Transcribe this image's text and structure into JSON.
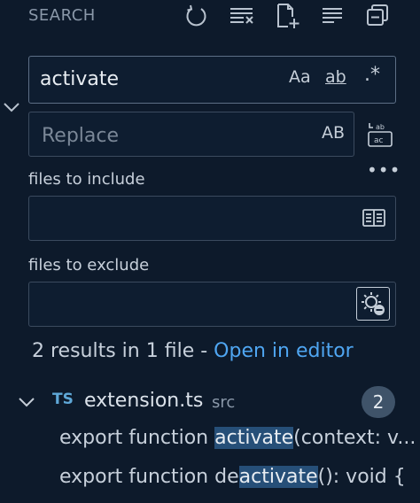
{
  "header": {
    "title": "SEARCH",
    "icons": [
      "refresh-icon",
      "clear-results-icon",
      "new-search-editor-icon",
      "collapse-all-icon",
      "view-as-tree-icon"
    ]
  },
  "search": {
    "value": "activate",
    "match_case_label": "Aa",
    "whole_word_label": "ab",
    "regex_label": ".*"
  },
  "replace": {
    "placeholder": "Replace",
    "preserve_case_label": "AB"
  },
  "include": {
    "label": "files to include",
    "value": ""
  },
  "exclude": {
    "label": "files to exclude",
    "value": ""
  },
  "results": {
    "summary": "2 results in 1 file",
    "separator": " - ",
    "open_in_editor": "Open in editor"
  },
  "file": {
    "lang_badge": "TS",
    "name": "extension.ts",
    "path": "src",
    "count": "2"
  },
  "matches": [
    {
      "before": "export function ",
      "match": "activate",
      "after": "(context: v..."
    },
    {
      "before": "export function de",
      "match": "activate",
      "after": "(): void {"
    }
  ],
  "colors": {
    "background": "#0d1a2b",
    "link": "#4fa6f2",
    "highlight": "#264f78"
  }
}
